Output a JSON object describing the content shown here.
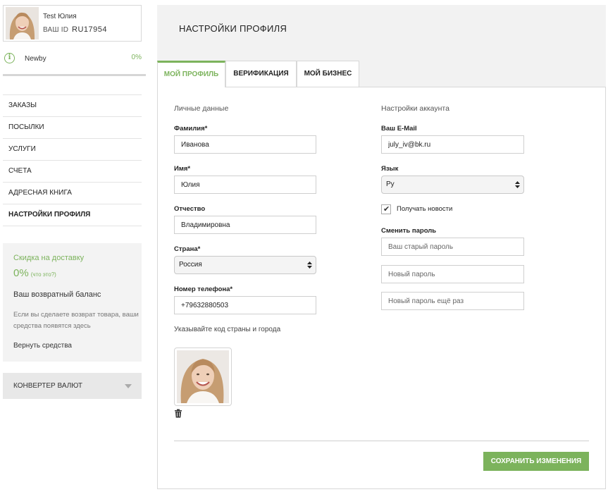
{
  "user": {
    "name": "Test Юлия",
    "id_label": "ВАШ ID",
    "id": "RU17954"
  },
  "level": {
    "name": "Newby",
    "percent": "0%",
    "progress": 0
  },
  "nav": {
    "items": [
      {
        "label": "ЗАКАЗЫ",
        "active": false
      },
      {
        "label": "ПОСЫЛКИ",
        "active": false
      },
      {
        "label": "УСЛУГИ",
        "active": false
      },
      {
        "label": "СЧЕТА",
        "active": false
      },
      {
        "label": "АДРЕСНАЯ КНИГА",
        "active": false
      },
      {
        "label": "НАСТРОЙКИ ПРОФИЛЯ",
        "active": true
      }
    ]
  },
  "discount": {
    "title": "Скидка на доставку",
    "value": "0%",
    "what_link": "(что это?)",
    "balance_title": "Ваш возвратный баланс",
    "balance_note": "Если вы сделаете возврат товара, ваши средства появятся здесь",
    "refund_link": "Вернуть средства"
  },
  "converter": {
    "label": "КОНВЕРТЕР ВАЛЮТ"
  },
  "page": {
    "title": "НАСТРОЙКИ ПРОФИЛЯ",
    "tabs": [
      {
        "label": "МОЙ ПРОФИЛЬ",
        "active": true
      },
      {
        "label": "ВЕРИФИКАЦИЯ",
        "active": false
      },
      {
        "label": "МОЙ БИЗНЕС",
        "active": false
      }
    ]
  },
  "personal": {
    "section_title": "Личные данные",
    "surname_label": "Фамилия*",
    "surname": "Иванова",
    "name_label": "Имя*",
    "name": "Юлия",
    "patronymic_label": "Отчество",
    "patronymic": "Владимировна",
    "country_label": "Страна*",
    "country": "Россия",
    "phone_label": "Номер телефона*",
    "phone": "+79632880503",
    "phone_hint": "Указывайте код страны и города"
  },
  "account": {
    "section_title": "Настройки аккаунта",
    "email_label": "Ваш E-Mail",
    "email": "july_iv@bk.ru",
    "language_label": "Язык",
    "language": "Ру",
    "newsletter_label": "Получать новости",
    "newsletter_checked": true,
    "password_label": "Сменить пароль",
    "old_password_placeholder": "Ваш старый пароль",
    "new_password_placeholder": "Новый пароль",
    "repeat_password_placeholder": "Новый пароль ещё раз"
  },
  "actions": {
    "save_label": "СОХРАНИТЬ ИЗМЕНЕНИЯ"
  },
  "colors": {
    "accent": "#7cb35c",
    "panel_bg": "#f2f2f2"
  }
}
